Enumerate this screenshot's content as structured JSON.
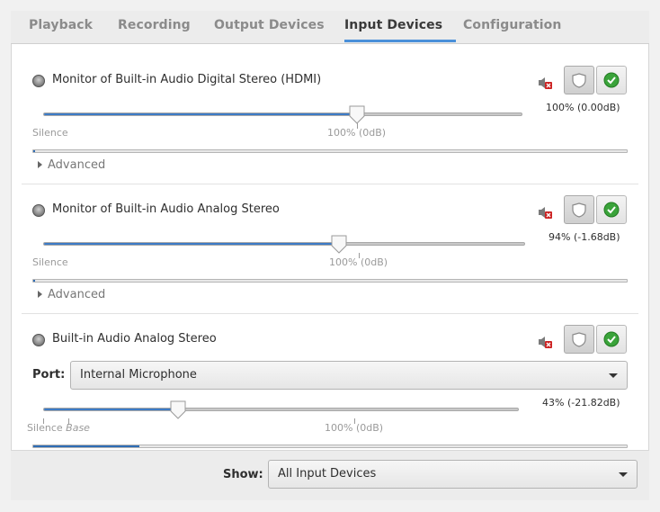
{
  "tabs": [
    {
      "label": "Playback",
      "active": false
    },
    {
      "label": "Recording",
      "active": false
    },
    {
      "label": "Output Devices",
      "active": false
    },
    {
      "label": "Input Devices",
      "active": true
    },
    {
      "label": "Configuration",
      "active": false
    }
  ],
  "devices": [
    {
      "name": "Monitor of Built-in Audio Digital Stereo (HDMI)",
      "volume_label": "100% (0.00dB)",
      "volume_percent": 100,
      "mark_silence": "Silence",
      "mark_100": "100% (0dB)",
      "advanced_label": "Advanced",
      "meter_level": 0.0,
      "muted_icon": "speaker-muted-icon",
      "lock_icon": "shield-icon",
      "default_icon": "check-icon"
    },
    {
      "name": "Monitor of Built-in Audio Analog Stereo",
      "volume_label": "94% (-1.68dB)",
      "volume_percent": 94,
      "mark_silence": "Silence",
      "mark_100": "100% (0dB)",
      "advanced_label": "Advanced",
      "meter_level": 0.0,
      "muted_icon": "speaker-muted-icon",
      "lock_icon": "shield-icon",
      "default_icon": "check-icon"
    },
    {
      "name": "Built-in Audio Analog Stereo",
      "port_label": "Port:",
      "port_value": "Internal Microphone",
      "volume_label": "43% (-21.82dB)",
      "volume_percent": 43,
      "mark_silence": "Silence",
      "mark_base": "Base",
      "mark_100": "100% (0dB)",
      "meter_level": 0.18,
      "muted_icon": "speaker-muted-icon",
      "lock_icon": "shield-icon",
      "default_icon": "check-icon"
    }
  ],
  "footer": {
    "show_label": "Show:",
    "show_value": "All Input Devices"
  },
  "colors": {
    "accent": "#4a90d9",
    "slider_fill": "#3d7bc6",
    "default_green": "#3aa33a"
  }
}
